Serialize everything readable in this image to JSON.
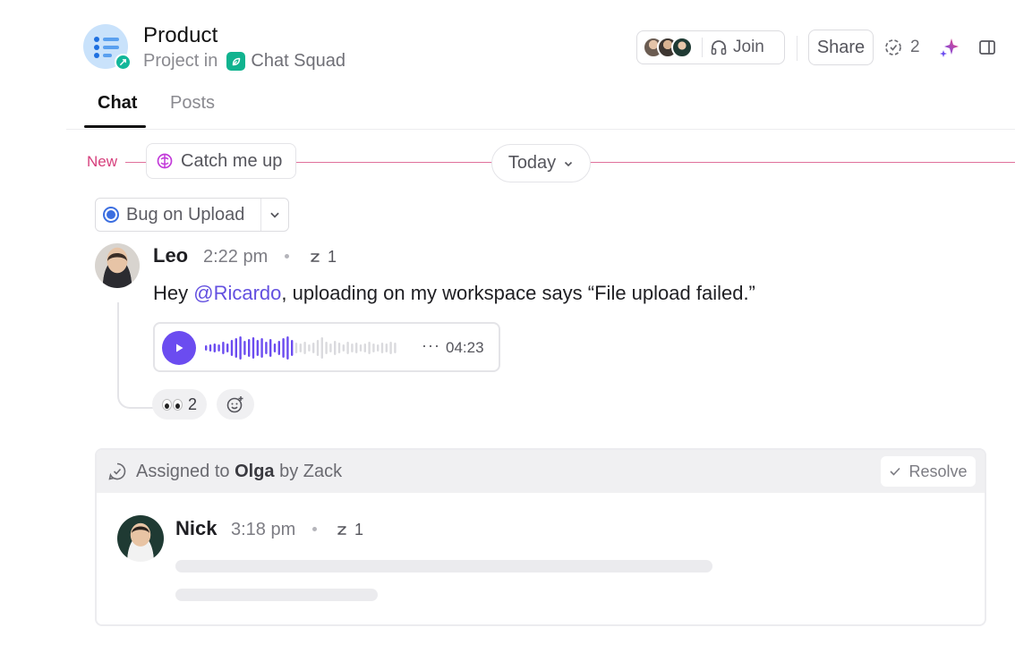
{
  "header": {
    "title": "Product",
    "subtitle_prefix": "Project in",
    "space_name": "Chat Squad",
    "join_label": "Join",
    "share_label": "Share",
    "follower_count": "2"
  },
  "tabs": [
    {
      "label": "Chat",
      "active": true
    },
    {
      "label": "Posts",
      "active": false
    }
  ],
  "divider": {
    "new_label": "New",
    "catch_up_label": "Catch me up",
    "date_label": "Today"
  },
  "topic": {
    "label": "Bug on Upload"
  },
  "message1": {
    "author": "Leo",
    "time": "2:22 pm",
    "reply_count": "1",
    "text_before": "Hey ",
    "mention": "@Ricardo",
    "text_after": ", uploading on my workspace says “File upload failed.”",
    "audio_duration": "04:23",
    "audio_progress": 0.45,
    "reaction_count": "2"
  },
  "assignment": {
    "prefix": "Assigned to ",
    "assignee": "Olga",
    "middle": " by ",
    "assigner": "Zack",
    "resolve_label": "Resolve"
  },
  "message2": {
    "author": "Nick",
    "time": "3:18 pm",
    "reply_count": "1"
  },
  "colors": {
    "accent": "#6b4cf0",
    "new_line": "#e0719c",
    "topic_blue": "#3b6ee0",
    "space_green": "#10b38f"
  }
}
